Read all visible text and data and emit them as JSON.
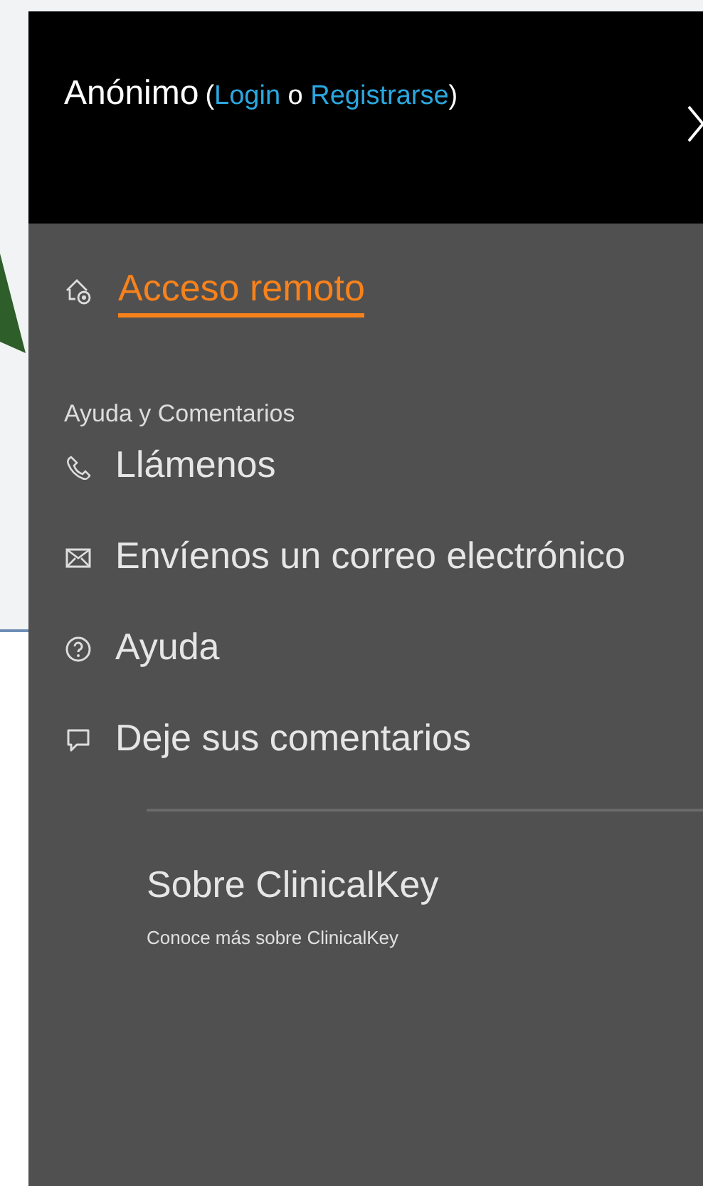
{
  "header": {
    "user": "Anónimo",
    "auth": {
      "before": "(",
      "login": "Login",
      "between": "o",
      "register": "Registrarse",
      "after": ")"
    }
  },
  "remote_access": {
    "label": "Acceso remoto"
  },
  "help_section": {
    "title": "Ayuda y Comentarios",
    "items": [
      {
        "kind": "phone",
        "label": "Llámenos"
      },
      {
        "kind": "mail",
        "label": "Envíenos un correo electrónico"
      },
      {
        "kind": "help",
        "label": "Ayuda"
      },
      {
        "kind": "comment",
        "label": "Deje sus comentarios"
      }
    ]
  },
  "about": {
    "title": "Sobre ClinicalKey",
    "subtitle": "Conoce más sobre ClinicalKey"
  }
}
